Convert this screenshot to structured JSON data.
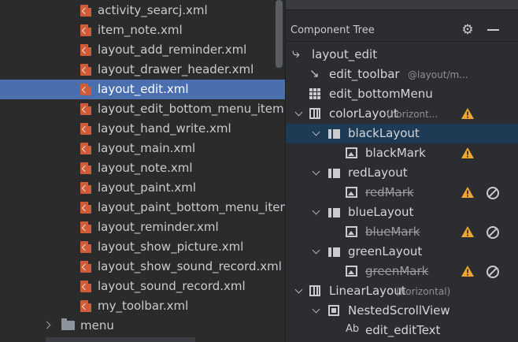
{
  "project_files": {
    "items": [
      {
        "name": "activity_searcj.xml"
      },
      {
        "name": "item_note.xml"
      },
      {
        "name": "layout_add_reminder.xml"
      },
      {
        "name": "layout_drawer_header.xml"
      },
      {
        "name": "layout_edit.xml",
        "selected": true
      },
      {
        "name": "layout_edit_bottom_menu_item.x"
      },
      {
        "name": "layout_hand_write.xml"
      },
      {
        "name": "layout_main.xml"
      },
      {
        "name": "layout_note.xml"
      },
      {
        "name": "layout_paint.xml"
      },
      {
        "name": "layout_paint_bottom_menu_item"
      },
      {
        "name": "layout_reminder.xml"
      },
      {
        "name": "layout_show_picture.xml"
      },
      {
        "name": "layout_show_sound_record.xml"
      },
      {
        "name": "layout_sound_record.xml"
      },
      {
        "name": "my_toolbar.xml"
      }
    ],
    "folder": {
      "name": "menu"
    }
  },
  "component_tree": {
    "title": "Component Tree",
    "gear_icon": "gear-icon",
    "minimize_icon": "minimize-icon",
    "rows": [
      {
        "label": "layout_edit",
        "icon": "merge-icon"
      },
      {
        "label": "edit_toolbar",
        "sub": "@layout/m...",
        "icon": "include-arrow-icon"
      },
      {
        "label": "edit_bottomMenu",
        "icon": "grid-icon"
      },
      {
        "label": "colorLayout",
        "sub": "(horizont...",
        "icon": "linear-layout-icon",
        "expanded": true,
        "warning": true
      },
      {
        "label": "blackLayout",
        "icon": "cell-icon",
        "expanded": true,
        "selected": true
      },
      {
        "label": "blackMark",
        "icon": "image-icon",
        "warning": true
      },
      {
        "label": "redLayout",
        "icon": "cell-icon",
        "expanded": true
      },
      {
        "label": "redMark",
        "icon": "image-icon",
        "struck": true,
        "warning": true,
        "blocked": true
      },
      {
        "label": "blueLayout",
        "icon": "cell-icon",
        "expanded": true
      },
      {
        "label": "blueMark",
        "icon": "image-icon",
        "struck": true,
        "warning": true,
        "blocked": true
      },
      {
        "label": "greenLayout",
        "icon": "cell-icon",
        "expanded": true
      },
      {
        "label": "greenMark",
        "icon": "image-icon",
        "struck": true,
        "warning": true,
        "blocked": true
      },
      {
        "label": "LinearLayout",
        "sub": "(horizontal)",
        "icon": "linear-layout-icon",
        "expanded": true
      },
      {
        "label": "NestedScrollView",
        "icon": "scroll-view-icon",
        "expanded": true
      },
      {
        "label": "edit_editText",
        "icon": "text-field-icon",
        "icon_text": "Ab"
      }
    ]
  },
  "colors": {
    "selection_left": "#4b6eaf",
    "selection_right": "#1d3b54",
    "warning": "#f0a732",
    "file_icon": "#cf5b38"
  }
}
